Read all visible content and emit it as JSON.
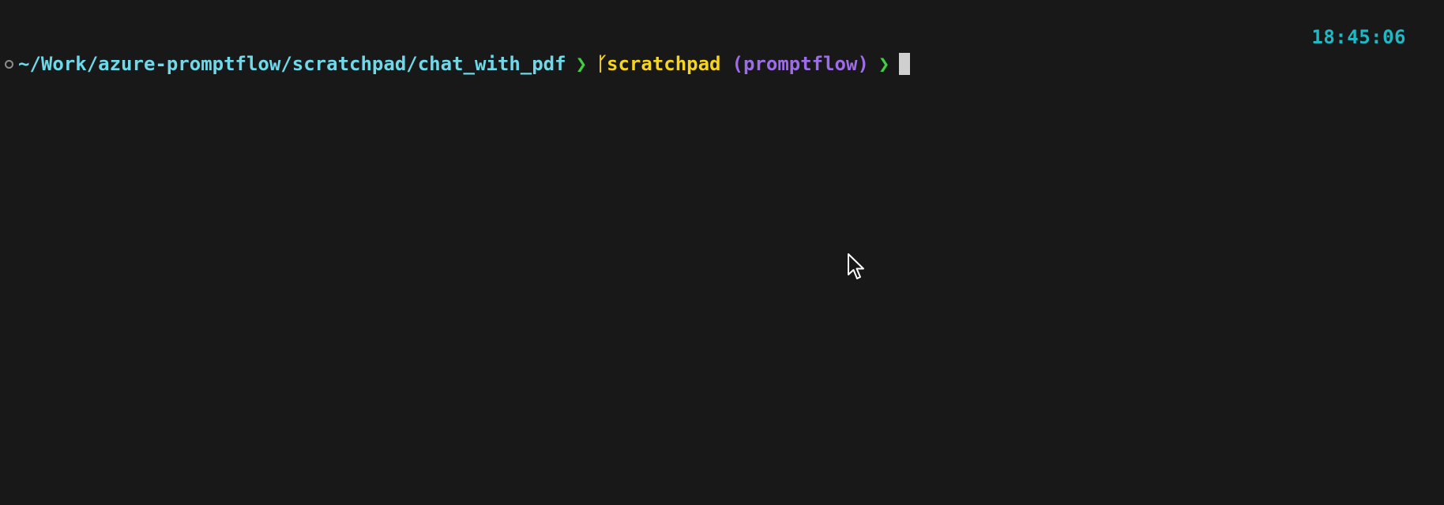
{
  "clock": {
    "time": "18:45:06"
  },
  "prompt": {
    "path": "~/Work/azure-promptflow/scratchpad/chat_with_pdf",
    "separator": "❯",
    "branch_icon": "git-branch-icon",
    "branch": "scratchpad",
    "env": "(promptflow)",
    "end_separator": "❯"
  },
  "colors": {
    "background": "#181818",
    "clock": "#1fb8c5",
    "path": "#6fd9ea",
    "arrow": "#3fd13f",
    "branch": "#f6d51c",
    "env": "#9d6ce8"
  }
}
